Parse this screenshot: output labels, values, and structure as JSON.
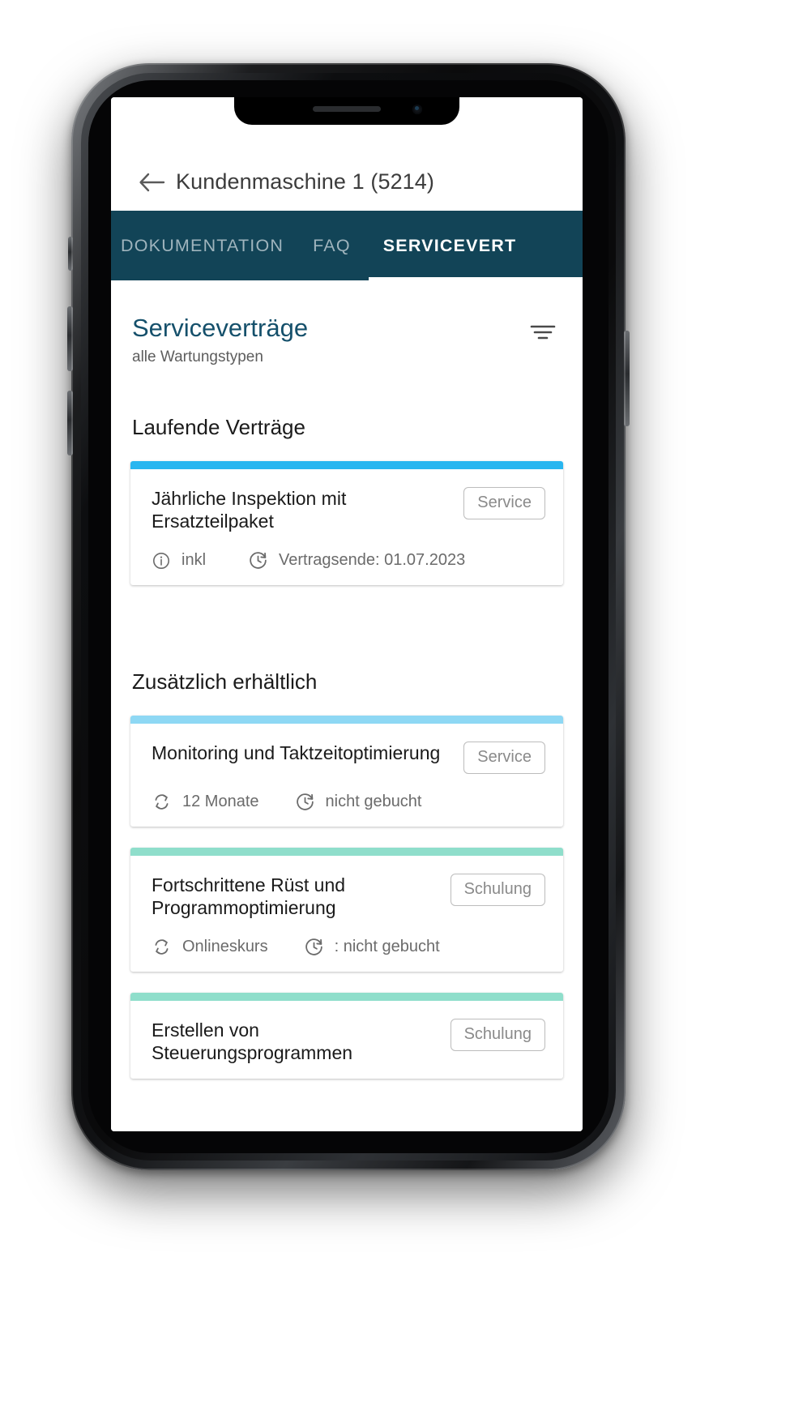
{
  "appbar": {
    "back_icon": "arrow-left-icon",
    "title": "Kundenmaschine 1 (5214)"
  },
  "tabs": [
    {
      "label": "DOKUMENTATION",
      "active": false
    },
    {
      "label": "FAQ",
      "active": false
    },
    {
      "label": "SERVICEVERT",
      "active": true
    }
  ],
  "page": {
    "title": "Serviceverträge",
    "subtitle": "alle Wartungstypen",
    "filter_icon": "filter-icon"
  },
  "sections": [
    {
      "heading": "Laufende Verträge",
      "cards": [
        {
          "accent_color": "#29b6f0",
          "name": "Jährliche Inspektion mit Ersatzteilpaket",
          "badge": "Service",
          "meta": [
            {
              "icon": "info-icon",
              "text": "inkl"
            },
            {
              "icon": "clock-refresh-icon",
              "text": "Vertragsende: 01.07.2023"
            }
          ]
        }
      ]
    },
    {
      "heading": "Zusätzlich erhältlich",
      "cards": [
        {
          "accent_color": "#8ed8f4",
          "name": "Monitoring und Taktzeitoptimierung",
          "badge": "Service",
          "meta": [
            {
              "icon": "sync-icon",
              "text": "12 Monate"
            },
            {
              "icon": "clock-refresh-icon",
              "text": "nicht gebucht"
            }
          ]
        },
        {
          "accent_color": "#8fdecb",
          "name": "Fortschrittene Rüst und Programmoptimierung",
          "badge": "Schulung",
          "meta": [
            {
              "icon": "sync-icon",
              "text": "Onlineskurs"
            },
            {
              "icon": "clock-refresh-icon",
              "text": ": nicht gebucht"
            }
          ]
        },
        {
          "accent_color": "#8fdecb",
          "name": "Erstellen von Steuerungsprogrammen",
          "badge": "Schulung",
          "meta": []
        }
      ]
    }
  ],
  "colors": {
    "tabbar_bg": "#124457",
    "title_blue": "#15506b",
    "accent_cyan": "#29b6f0",
    "accent_light_blue": "#8ed8f4",
    "accent_mint": "#8fdecb"
  }
}
